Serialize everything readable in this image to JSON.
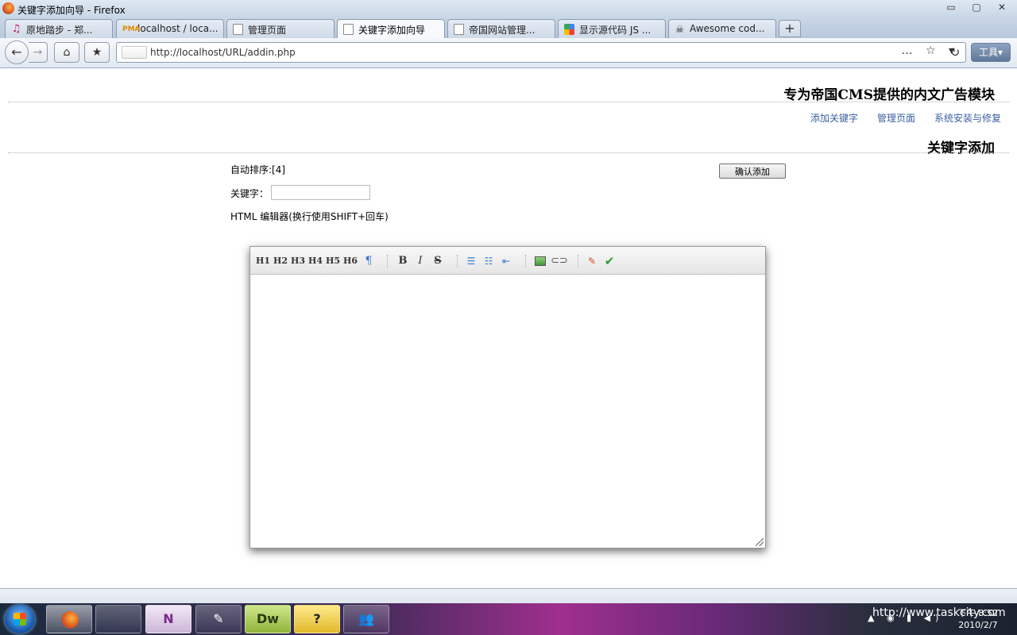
{
  "window": {
    "title": "关键字添加向导 - Firefox",
    "controls": [
      "▭",
      "▢",
      "✕"
    ]
  },
  "tabs": [
    {
      "label": "原地踏步 - 郑...",
      "icon": "music-note-icon"
    },
    {
      "label": "localhost / loca...",
      "icon": "pma-icon"
    },
    {
      "label": "管理页面",
      "icon": "page-icon"
    },
    {
      "label": "关键字添加向导",
      "icon": "page-icon",
      "active": true
    },
    {
      "label": "帝国网站管理...",
      "icon": "page-icon"
    },
    {
      "label": "显示源代码 JS ...",
      "icon": "google-icon"
    },
    {
      "label": "Awesome cod...",
      "icon": "skull-icon"
    }
  ],
  "newtab_label": "+",
  "nav": {
    "back": "←",
    "forward": "→",
    "home": "⌂",
    "bookmark": "★",
    "url": "http://localhost/URL/addin.php",
    "url_actions": "… ☆ ▾",
    "reload": "↻",
    "tools_label": "工具▾"
  },
  "page": {
    "brand": "专为帝国CMS提供的内文广告模块",
    "links": [
      "添加关键字",
      "管理页面",
      "系统安装与修复"
    ],
    "section_title": "关键字添加",
    "auto_sort": "自动排序:[4]",
    "keyword_label": "关键字：",
    "keyword_value": "",
    "confirm_label": "确认添加",
    "editor_label": "HTML 编辑器(换行使用SHIFT+回车)"
  },
  "editor": {
    "headings": [
      "H1",
      "H2",
      "H3",
      "H4",
      "H5",
      "H6"
    ],
    "paragraph": "¶",
    "bold": "B",
    "italic": "I",
    "strike": "S",
    "ul": "☰",
    "ol": "☷",
    "outdent": "⇤",
    "link": "⊂⊃",
    "code": "✎",
    "ok": "✔",
    "content": ""
  },
  "taskbar": {
    "apps": [
      "",
      "",
      "N",
      "✎",
      "Dw",
      "?",
      "👥"
    ],
    "tray": "▲ ◉ ▮ ◀)",
    "time": "下午 8:52",
    "date": "2010/2/7",
    "watermark": "http://www.taskcity.com"
  }
}
